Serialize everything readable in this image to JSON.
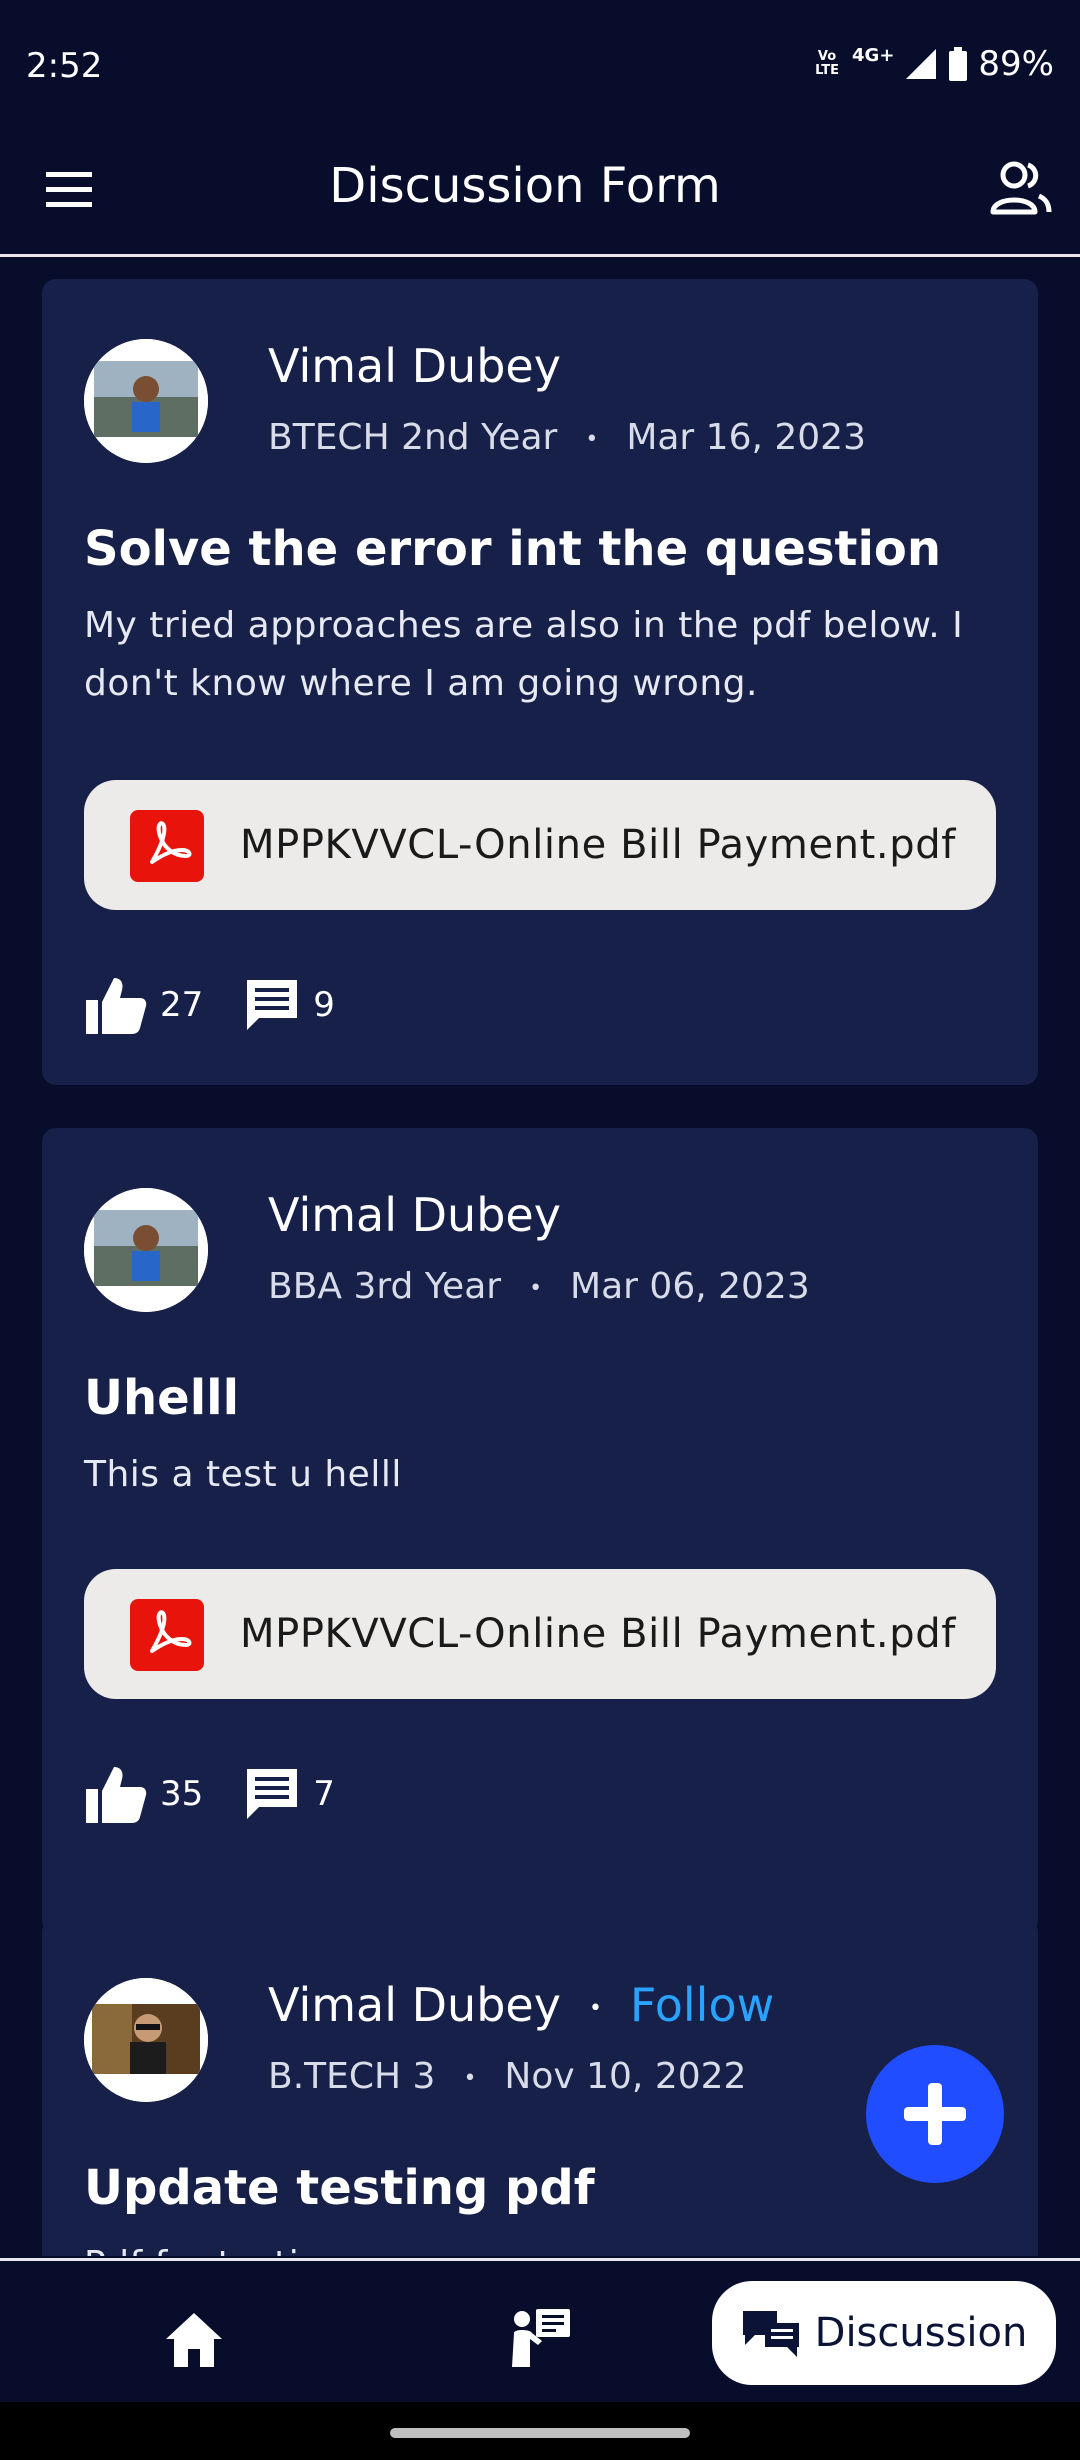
{
  "status_bar": {
    "time": "2:52",
    "volte": "Vo LTE",
    "network": "4G+",
    "battery": "89%"
  },
  "app_bar": {
    "title": "Discussion Form"
  },
  "posts": [
    {
      "author": "Vimal Dubey",
      "course": "BTECH 2nd Year",
      "date": "Mar 16, 2023",
      "title": "Solve the error int the question",
      "body": "My tried approaches are also in the pdf below. I don't know where I am going wrong.",
      "attachment": "MPPKVVCL-Online Bill Payment.pdf",
      "likes": "27",
      "comments": "9"
    },
    {
      "author": "Vimal Dubey",
      "course": "BBA 3rd Year",
      "date": "Mar 06, 2023",
      "title": "Uhelll",
      "body": "This a test u helll",
      "attachment": "MPPKVVCL-Online Bill Payment.pdf",
      "likes": "35",
      "comments": "7"
    },
    {
      "author": "Vimal Dubey",
      "follow_label": "Follow",
      "course": "B.TECH 3",
      "date": "Nov 10, 2022",
      "title": "Update testing pdf",
      "body": "Pdf for testing"
    }
  ],
  "bottom_nav": {
    "discussion_label": "Discussion"
  },
  "icons": [
    "menu-icon",
    "people-icon",
    "pdf-icon",
    "thumbs-up-icon",
    "comment-icon",
    "plus-icon",
    "home-icon",
    "teacher-icon",
    "forum-icon"
  ],
  "colors": {
    "background": "#070d2b",
    "card": "#172048",
    "accent": "#1f4dff",
    "follow": "#2aa2ff",
    "pdf": "#e8140c"
  }
}
